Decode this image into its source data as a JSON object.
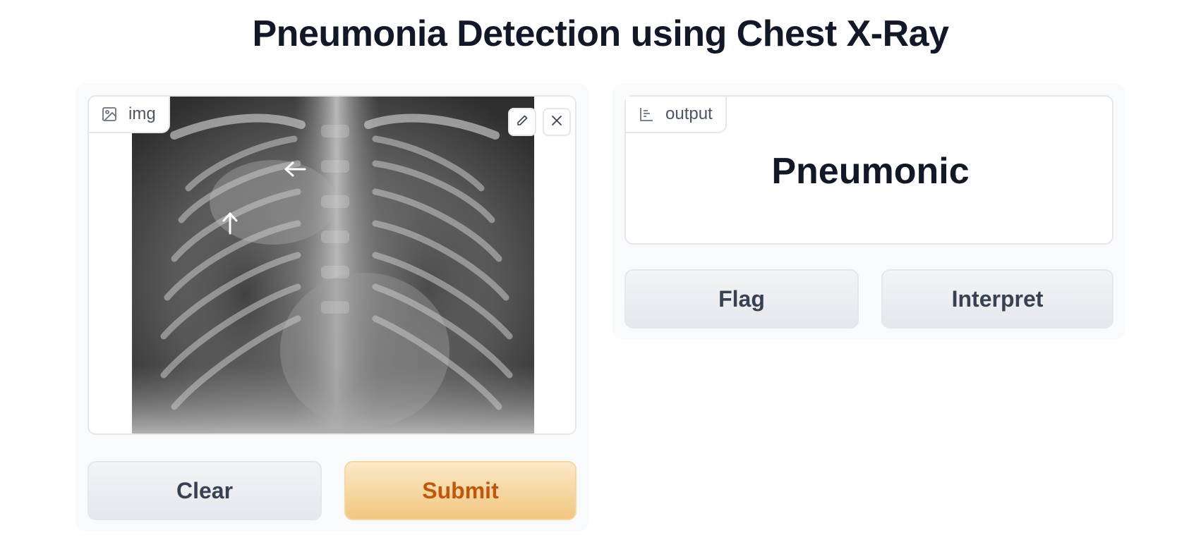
{
  "page": {
    "title": "Pneumonia Detection using Chest X-Ray"
  },
  "input": {
    "label": "img",
    "label_icon": "image-icon",
    "tools": {
      "edit_icon": "pencil-icon",
      "clear_icon": "close-icon"
    }
  },
  "output": {
    "label": "output",
    "label_icon": "bar-chart-icon",
    "value": "Pneumonic"
  },
  "buttons": {
    "clear": "Clear",
    "submit": "Submit",
    "flag": "Flag",
    "interpret": "Interpret"
  },
  "colors": {
    "primary_text": "#c2570b",
    "primary_bg": "#f1c77f",
    "secondary_bg": "#e5e7eb",
    "panel_bg": "#f9fafb"
  }
}
